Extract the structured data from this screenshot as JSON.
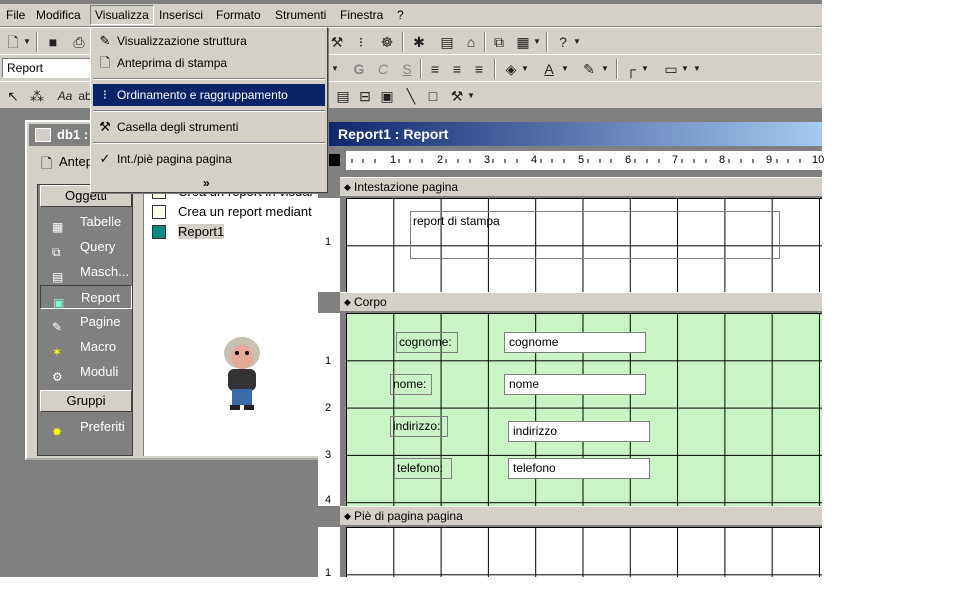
{
  "menubar": {
    "items": [
      "File",
      "Modifica",
      "Visualizza",
      "Inserisci",
      "Formato",
      "Strumenti",
      "Finestra",
      "?"
    ]
  },
  "toolbar": {
    "object_combo": "Report",
    "font_buttons": [
      "G",
      "C",
      "S"
    ]
  },
  "view_menu": {
    "items": [
      {
        "label": "Visualizzazione struttura",
        "icon": "design-view-icon"
      },
      {
        "label": "Anteprima di stampa",
        "icon": "print-preview-icon"
      },
      {
        "label": "Ordinamento e raggruppamento",
        "icon": "sorting-grouping-icon",
        "highlighted": true
      },
      {
        "label": "Casella degli strumenti",
        "icon": "toolbox-icon"
      },
      {
        "label": "Int./piè pagina pagina",
        "icon": "check-icon",
        "checked": true
      }
    ],
    "more": "»"
  },
  "db_window": {
    "title": "db1 :",
    "preview_button": "Antep",
    "objects_header": "Oggetti",
    "groups_header": "Gruppi",
    "objects": [
      "Tabelle",
      "Query",
      "Masch...",
      "Report",
      "Pagine",
      "Macro",
      "Moduli"
    ],
    "groups": [
      "Preferiti"
    ],
    "selected": "Report",
    "list": [
      "Crea un report in visual",
      "Crea un report mediant",
      "Report1"
    ]
  },
  "report_window": {
    "title": "Report1 : Report",
    "ruler_marks": [
      "1",
      "2",
      "3",
      "4",
      "5",
      "6",
      "7",
      "8",
      "9",
      "10"
    ],
    "vruler_marks_header": [
      "1"
    ],
    "vruler_marks_body": [
      "1",
      "2",
      "3",
      "4"
    ],
    "vruler_marks_footer": [
      "1"
    ],
    "sections": {
      "header": "Intestazione pagina",
      "body": "Corpo",
      "footer": "Piè di pagina pagina"
    },
    "header_label": "report di stampa",
    "fields": [
      {
        "label": "cognome:",
        "value": "cognome"
      },
      {
        "label": "nome:",
        "value": "nome"
      },
      {
        "label": "indirizzo:",
        "value": "indirizzo"
      },
      {
        "label": "telefono:",
        "value": "telefono"
      }
    ]
  },
  "colors": {
    "face": "#d4d0c8",
    "highlight": "#0a246a",
    "body_section": "#c9f4c3"
  }
}
